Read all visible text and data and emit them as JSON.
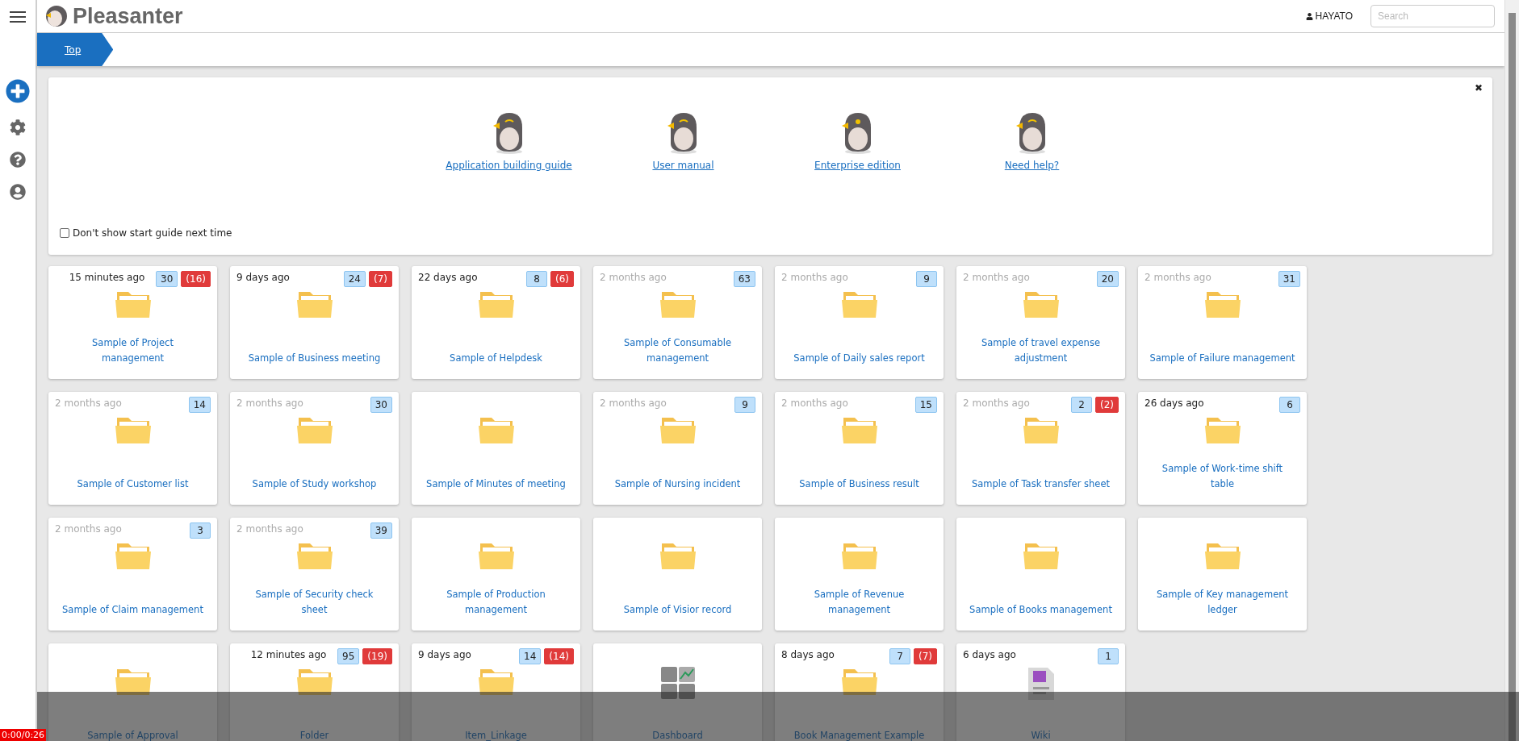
{
  "app": {
    "name": "Pleasanter"
  },
  "user": {
    "name": "HAYATO"
  },
  "search": {
    "placeholder": "Search"
  },
  "breadcrumb": [
    {
      "label": "Top"
    }
  ],
  "start_guide": {
    "close": "✖",
    "links": [
      "Application building guide",
      "User manual",
      "Enterprise edition",
      "Need help?"
    ],
    "checkbox": {
      "label": "Don't show start guide next time",
      "checked": false
    }
  },
  "sites": [
    {
      "kind": "folder",
      "time": "15 minutes ago",
      "recent": true,
      "count": "30",
      "overdue": "(16)",
      "title": "Sample of Project management"
    },
    {
      "kind": "folder",
      "time": "9 days ago",
      "recent": true,
      "count": "24",
      "overdue": "(7)",
      "title": "Sample of Business meeting"
    },
    {
      "kind": "folder",
      "time": "22 days ago",
      "recent": true,
      "count": "8",
      "overdue": "(6)",
      "title": "Sample of Helpdesk"
    },
    {
      "kind": "folder",
      "time": "2 months ago",
      "recent": false,
      "count": "63",
      "title": "Sample of Consumable management"
    },
    {
      "kind": "folder",
      "time": "2 months ago",
      "recent": false,
      "count": "9",
      "title": "Sample of Daily sales report"
    },
    {
      "kind": "folder",
      "time": "2 months ago",
      "recent": false,
      "count": "20",
      "title": "Sample of travel expense adjustment"
    },
    {
      "kind": "folder",
      "time": "2 months ago",
      "recent": false,
      "count": "31",
      "title": "Sample of Failure management"
    },
    {
      "kind": "folder",
      "time": "2 months ago",
      "recent": false,
      "count": "14",
      "title": "Sample of Customer list"
    },
    {
      "kind": "folder",
      "time": "2 months ago",
      "recent": false,
      "count": "30",
      "title": "Sample of Study workshop"
    },
    {
      "kind": "folder",
      "title": "Sample of Minutes of meeting"
    },
    {
      "kind": "folder",
      "time": "2 months ago",
      "recent": false,
      "count": "9",
      "title": "Sample of Nursing incident"
    },
    {
      "kind": "folder",
      "time": "2 months ago",
      "recent": false,
      "count": "15",
      "title": "Sample of Business result"
    },
    {
      "kind": "folder",
      "time": "2 months ago",
      "recent": false,
      "count": "2",
      "overdue": "(2)",
      "title": "Sample of Task transfer sheet"
    },
    {
      "kind": "folder",
      "time": "26 days ago",
      "recent": true,
      "count": "6",
      "title": "Sample of Work-time shift table"
    },
    {
      "kind": "folder",
      "time": "2 months ago",
      "recent": false,
      "count": "3",
      "title": "Sample of Claim management"
    },
    {
      "kind": "folder",
      "time": "2 months ago",
      "recent": false,
      "count": "39",
      "title": "Sample of Security check sheet"
    },
    {
      "kind": "folder",
      "title": "Sample of Production management"
    },
    {
      "kind": "folder",
      "title": "Sample of Visior record"
    },
    {
      "kind": "folder",
      "title": "Sample of Revenue management"
    },
    {
      "kind": "folder",
      "title": "Sample of Books management"
    },
    {
      "kind": "folder",
      "title": "Sample of Key management ledger"
    },
    {
      "kind": "folder",
      "title": "Sample of Approval"
    },
    {
      "kind": "folder",
      "time": "12 minutes ago",
      "recent": true,
      "count": "95",
      "overdue": "(19)",
      "title": "Folder"
    },
    {
      "kind": "folder",
      "time": "9 days ago",
      "recent": true,
      "count": "14",
      "overdue": "(14)",
      "title": "Item_Linkage"
    },
    {
      "kind": "dashboard",
      "title": "Dashboard"
    },
    {
      "kind": "folder",
      "time": "8 days ago",
      "recent": true,
      "count": "7",
      "overdue": "(7)",
      "title": "Book Management Example"
    },
    {
      "kind": "wiki",
      "time": "6 days ago",
      "recent": true,
      "count": "1",
      "title": "Wiki"
    }
  ],
  "player": {
    "time": "0:00/0:26"
  }
}
